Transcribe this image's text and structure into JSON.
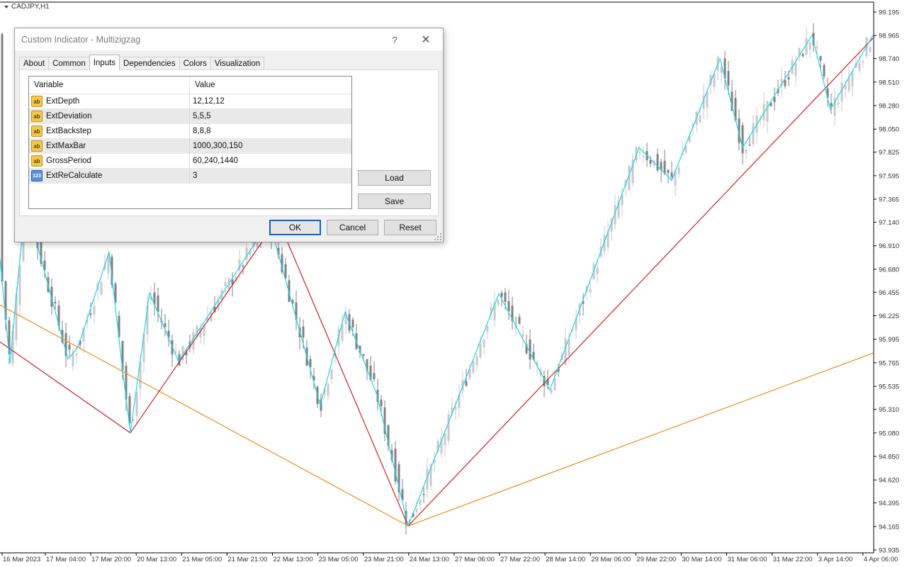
{
  "window": {
    "symbol_title": "CADJPY,H1"
  },
  "chart_data": {
    "type": "candlestick",
    "symbol": "CADJPY",
    "timeframe": "H1",
    "y_axis_labels": [
      "99.195",
      "98.965",
      "98.740",
      "98.510",
      "98.280",
      "98.050",
      "97.825",
      "97.595",
      "97.365",
      "97.140",
      "96.910",
      "96.680",
      "96.455",
      "96.225",
      "95.995",
      "95.765",
      "95.535",
      "95.310",
      "95.080",
      "94.850",
      "94.620",
      "94.395",
      "94.165",
      "93.935"
    ],
    "x_axis_labels": [
      "16 Mar 2023",
      "17 Mar 04:00",
      "17 Mar 20:00",
      "20 Mar 13:00",
      "21 Mar 05:00",
      "21 Mar 21:00",
      "22 Mar 13:00",
      "23 Mar 05:00",
      "23 Mar 21:00",
      "24 Mar 13:00",
      "27 Mar 06:00",
      "27 Mar 22:00",
      "28 Mar 14:00",
      "29 Mar 06:00",
      "29 Mar 22:00",
      "30 Mar 14:00",
      "31 Mar 06:00",
      "31 Mar 22:00",
      "3 Apr 14:00",
      "4 Apr 06:00"
    ],
    "ylim": [
      93.935,
      99.195
    ],
    "zigzag_lines": [
      {
        "timeframe_minutes": 60,
        "color": "#22d3ee",
        "points": [
          [
            0,
            96.78
          ],
          [
            14,
            95.76
          ],
          [
            36,
            97.35
          ],
          [
            96,
            95.8
          ],
          [
            110,
            95.92
          ],
          [
            154,
            96.85
          ],
          [
            172,
            95.75
          ],
          [
            184,
            95.08
          ],
          [
            211,
            96.45
          ],
          [
            252,
            95.78
          ],
          [
            380,
            97.15
          ],
          [
            452,
            95.35
          ],
          [
            487,
            96.26
          ],
          [
            532,
            95.45
          ],
          [
            576,
            94.17
          ],
          [
            704,
            96.44
          ],
          [
            776,
            95.5
          ],
          [
            902,
            97.87
          ],
          [
            948,
            97.55
          ],
          [
            1016,
            98.74
          ],
          [
            1048,
            97.87
          ],
          [
            1146,
            98.97
          ],
          [
            1172,
            98.24
          ],
          [
            1232,
            98.97
          ]
        ]
      },
      {
        "timeframe_minutes": 240,
        "color": "#cc2222",
        "points": [
          [
            0,
            95.97
          ],
          [
            184,
            95.08
          ],
          [
            392,
            97.17
          ],
          [
            576,
            94.17
          ],
          [
            1232,
            98.94
          ]
        ]
      },
      {
        "timeframe_minutes": 1440,
        "color": "#f08a1c",
        "points": [
          [
            0,
            96.33
          ],
          [
            576,
            94.17
          ],
          [
            1232,
            95.86
          ]
        ]
      }
    ]
  },
  "dialog": {
    "title": "Custom Indicator - Multizigzag",
    "help_label": "?",
    "close_label": "✕",
    "tabs": [
      "About",
      "Common",
      "Inputs",
      "Dependencies",
      "Colors",
      "Visualization"
    ],
    "active_tab": "Inputs",
    "table": {
      "headers": [
        "Variable",
        "Value"
      ],
      "rows": [
        {
          "icon": "ab",
          "name": "ExtDepth",
          "value": "12,12,12"
        },
        {
          "icon": "ab",
          "name": "ExtDeviation",
          "value": "5,5,5"
        },
        {
          "icon": "ab",
          "name": "ExtBackstep",
          "value": "8,8,8"
        },
        {
          "icon": "ab",
          "name": "ExtMaxBar",
          "value": "1000,300,150"
        },
        {
          "icon": "ab",
          "name": "GrossPeriod",
          "value": "60,240,1440"
        },
        {
          "icon": "123",
          "name": "ExtReCalculate",
          "value": "3"
        }
      ]
    },
    "buttons": {
      "load": "Load",
      "save": "Save",
      "ok": "OK",
      "cancel": "Cancel",
      "reset": "Reset"
    }
  }
}
